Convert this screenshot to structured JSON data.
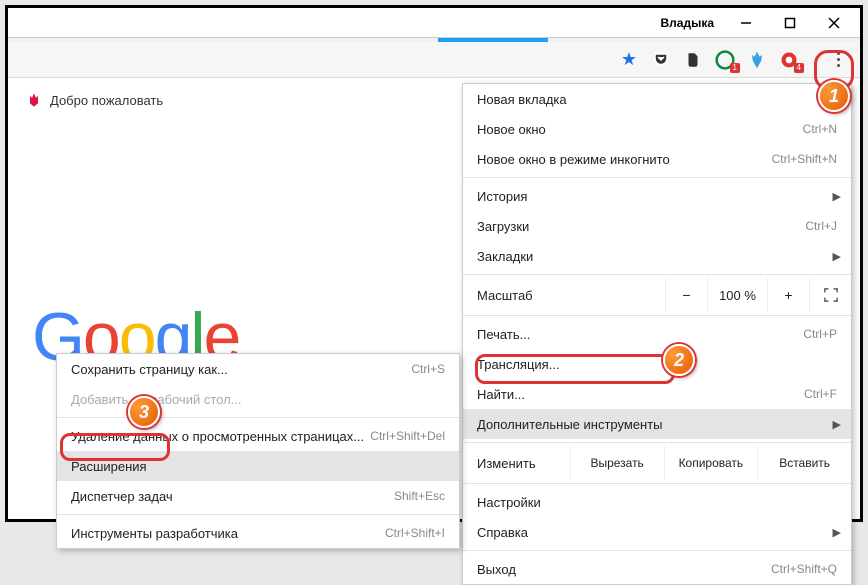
{
  "window": {
    "user": "Владыка"
  },
  "bookmark": {
    "welcome": "Добро пожаловать"
  },
  "logo": {
    "g1": "G",
    "o1": "o",
    "o2": "o",
    "g2": "g",
    "l": "l",
    "e": "e"
  },
  "menu": {
    "new_tab": "Новая вкладка",
    "new_window": "Новое окно",
    "new_window_sc": "Ctrl+N",
    "incognito": "Новое окно в режиме инкогнито",
    "incognito_sc": "Ctrl+Shift+N",
    "history": "История",
    "downloads": "Загрузки",
    "downloads_sc": "Ctrl+J",
    "bookmarks": "Закладки",
    "zoom_label": "Масштаб",
    "zoom_minus": "−",
    "zoom_value": "100 %",
    "zoom_plus": "+",
    "print": "Печать...",
    "print_sc": "Ctrl+P",
    "cast": "Трансляция...",
    "find": "Найти...",
    "find_sc": "Ctrl+F",
    "more_tools": "Дополнительные инструменты",
    "edit_label": "Изменить",
    "cut": "Вырезать",
    "copy": "Копировать",
    "paste": "Вставить",
    "settings": "Настройки",
    "help": "Справка",
    "exit": "Выход",
    "exit_sc": "Ctrl+Shift+Q"
  },
  "submenu": {
    "save_as": "Сохранить страницу как...",
    "save_as_sc": "Ctrl+S",
    "add_desktop": "Добавить на рабочий стол...",
    "clear_data": "Удаление данных о просмотренных страницах...",
    "clear_data_sc": "Ctrl+Shift+Del",
    "extensions": "Расширения",
    "task_mgr": "Диспетчер задач",
    "task_mgr_sc": "Shift+Esc",
    "dev_tools": "Инструменты разработчика",
    "dev_tools_sc": "Ctrl+Shift+I"
  },
  "callouts": {
    "n1": "1",
    "n2": "2",
    "n3": "3"
  },
  "toolbar": {
    "badge1": "1",
    "badge4": "4"
  }
}
